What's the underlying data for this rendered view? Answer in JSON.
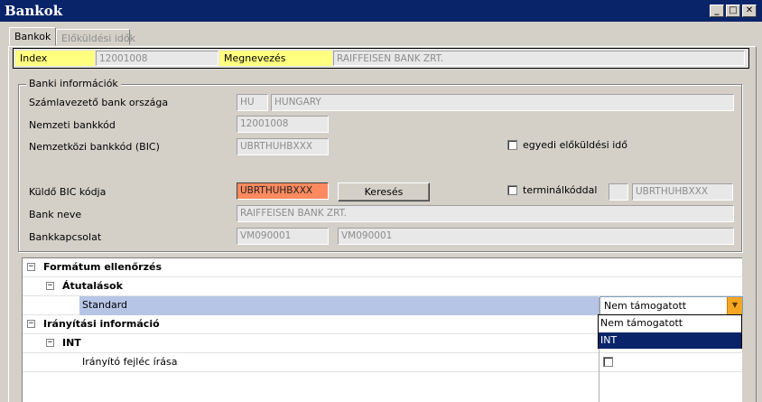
{
  "window": {
    "title": "Bankok",
    "min_glyph": "_",
    "max_glyph": "□",
    "close_glyph": "✕"
  },
  "tabs": [
    {
      "label": "Bankok"
    },
    {
      "label": "Előküldési idők"
    }
  ],
  "header": {
    "index_label": "Index",
    "index_value": "12001008",
    "name_label": "Megnevezés",
    "name_value": "RAIFFEISEN BANK ZRT."
  },
  "bank_info": {
    "legend": "Banki információk",
    "country_label": "Számlavezető bank országa",
    "country_code": "HU",
    "country_name": "HUNGARY",
    "national_code_label": "Nemzeti bankkód",
    "national_code": "12001008",
    "bic_label": "Nemzetközi bankkód (BIC)",
    "bic": "UBRTHUHBXXX",
    "custom_time_label": "egyedi előküldési idő",
    "sender_bic_label": "Küldő BIC kódja",
    "sender_bic": "UBRTHUHBXXX",
    "search_label": "Keresés",
    "terminal_label": "terminálkóddal",
    "terminal_value": "",
    "terminal_bic": "UBRTHUHBXXX",
    "bank_name_label": "Bank neve",
    "bank_name": "RAIFFEISEN BANK ZRT.",
    "relation_label": "Bankkapcsolat",
    "relation_code": "VM090001",
    "relation_name": "VM090001"
  },
  "grid": {
    "format_check_label": "Formátum ellenőrzés",
    "transfers_label": "Átutalások",
    "standard_label": "Standard",
    "standard_value": "Nem támogatott",
    "routing_label": "Irányítási információ",
    "int_label": "INT",
    "header_write_label": "Irányító fejléc írása",
    "collapse_glyph": "−",
    "combo_arrow": "▼"
  },
  "dropdown": {
    "options": [
      {
        "label": "Nem támogatott"
      },
      {
        "label": "INT"
      }
    ],
    "highlighted": "INT"
  },
  "colors": {
    "title_bar": "#0a246a",
    "highlight_yellow": "#ffff80",
    "error_orange": "#ff8a60",
    "selected_row": "#b6c5e6",
    "combo_button": "#f5a623"
  }
}
